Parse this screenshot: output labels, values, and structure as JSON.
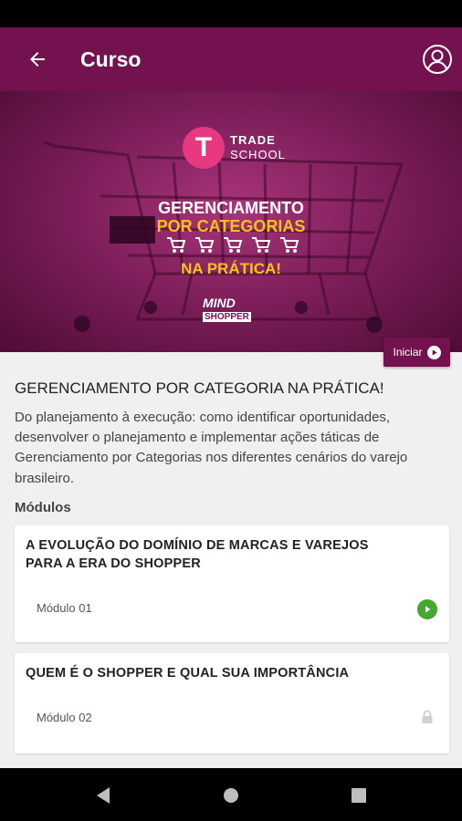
{
  "app_bar": {
    "title": "Curso",
    "back_icon": "arrow-left-icon",
    "profile_icon": "user-circle-icon",
    "color": "#74124f"
  },
  "banner": {
    "brand_badge": "T",
    "brand_line1": "TRADE",
    "brand_line2": "SCHOOL",
    "headline_line1": "GERENCIAMENTO",
    "headline_line2": "POR CATEGORIAS",
    "headline_line3": "NA PRÁTICA!",
    "partner_line1": "MIND",
    "partner_line2": "SHOPPER",
    "cart_icon_count": 5,
    "accent_color": "#f6c21a"
  },
  "start_button": {
    "label": "Iniciar",
    "icon": "play-circle-icon"
  },
  "course": {
    "title": "GERENCIAMENTO POR CATEGORIA NA PRÁTICA!",
    "description": "Do planejamento à execução: como identificar oportunidades, desenvolver o planejamento e implementar ações táticas de Gerenciamento por Categorias nos diferentes cenários do varejo brasileiro."
  },
  "modules_label": "Módulos",
  "modules": [
    {
      "title": "A EVOLUÇÃO DO DOMÍNIO DE MARCAS E VAREJOS PARA A ERA DO SHOPPER",
      "subtitle": "Módulo 01",
      "status_icon": "play-icon",
      "status_color": "#44a82f"
    },
    {
      "title": "QUEM É O SHOPPER E QUAL SUA IMPORTÂNCIA",
      "subtitle": "Módulo 02",
      "status_icon": "lock-icon",
      "status_color": "#d0d0d0"
    }
  ],
  "nav": {
    "back_icon": "nav-back-icon",
    "home_icon": "nav-home-icon",
    "recents_icon": "nav-recents-icon"
  }
}
